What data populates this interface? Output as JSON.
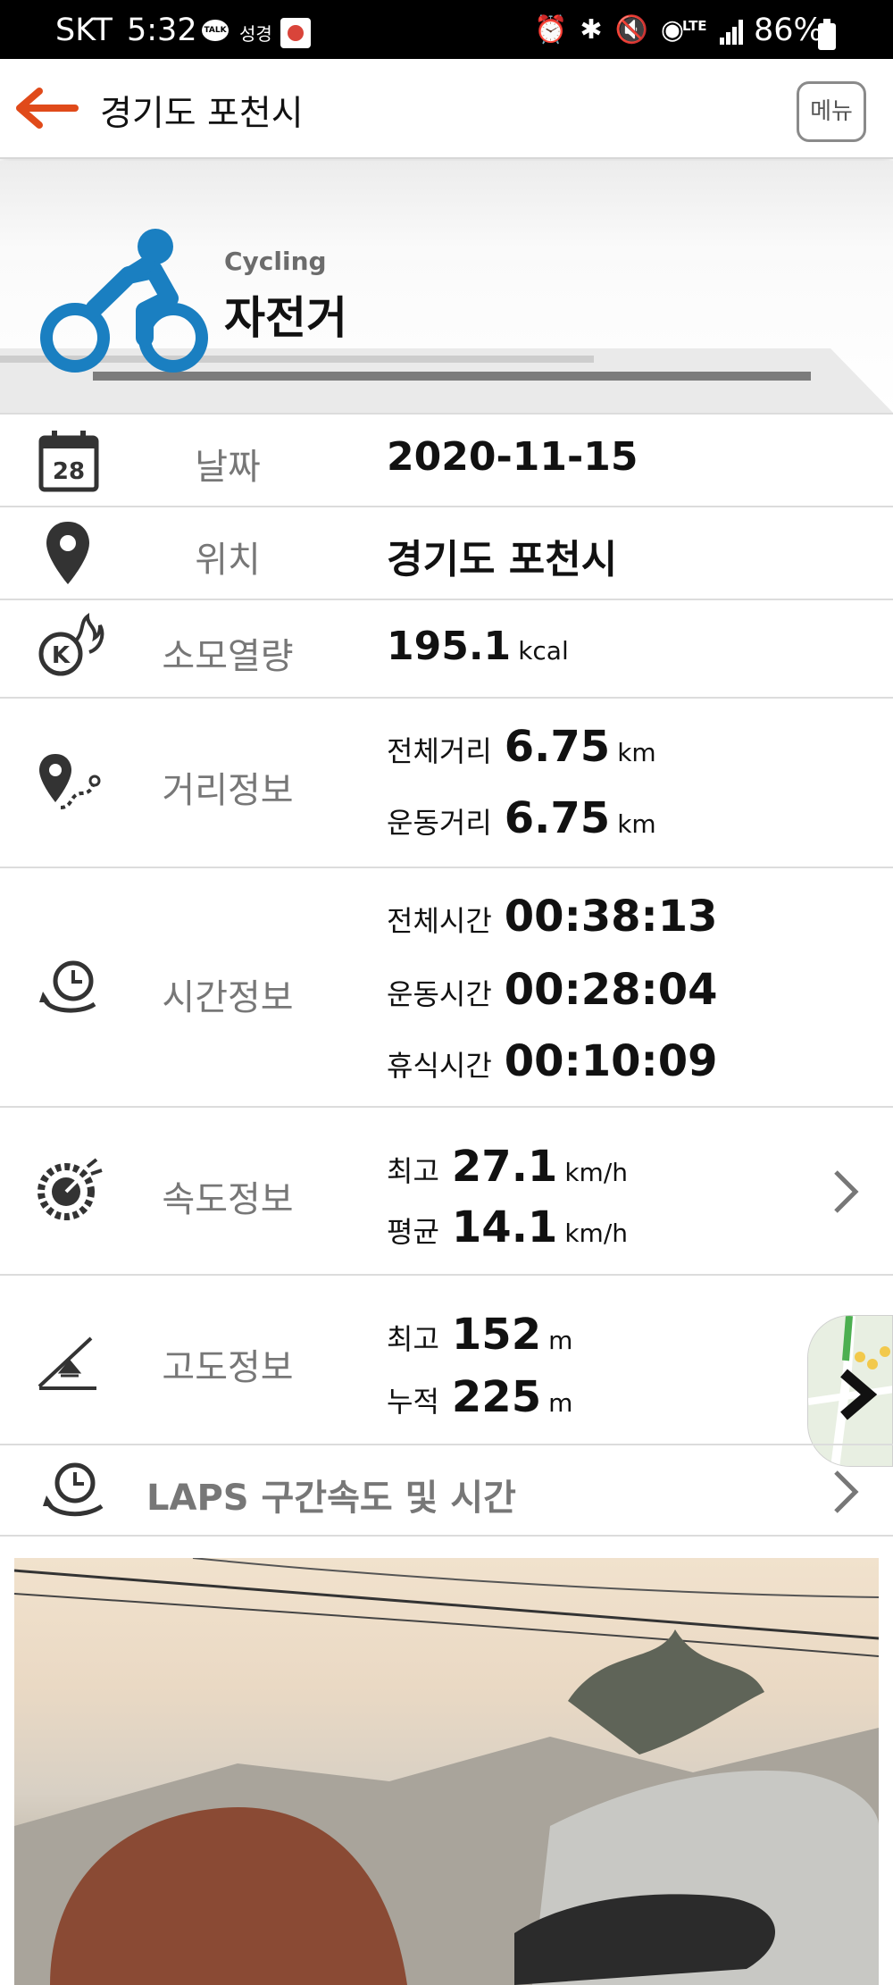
{
  "status_bar": {
    "carrier": "SKT",
    "time": "5:32",
    "talk_badge": "TALK",
    "sub_text": "성경",
    "lte": "LTE",
    "battery": "86%"
  },
  "header": {
    "title": "경기도 포천시",
    "menu_label": "메뉴"
  },
  "activity": {
    "subtitle": "Cycling",
    "title": "자전거",
    "accent_color": "#1a7fc1"
  },
  "rows": {
    "date": {
      "label": "날짜",
      "value": "2020-11-15",
      "icon": "calendar-icon",
      "icon_text": "28"
    },
    "location": {
      "label": "위치",
      "value": "경기도 포천시",
      "icon": "location-pin-icon"
    },
    "calories": {
      "label": "소모열량",
      "value": "195.1",
      "unit": "kcal",
      "icon": "calorie-flame-icon"
    },
    "distance": {
      "label": "거리정보",
      "icon": "route-pin-icon",
      "total_key": "전체거리",
      "total_value": "6.75",
      "total_unit": "km",
      "moving_key": "운동거리",
      "moving_value": "6.75",
      "moving_unit": "km"
    },
    "time": {
      "label": "시간정보",
      "icon": "clock-cycle-icon",
      "total_key": "전체시간",
      "total_value": "00:38:13",
      "moving_key": "운동시간",
      "moving_value": "00:28:04",
      "rest_key": "휴식시간",
      "rest_value": "00:10:09"
    },
    "speed": {
      "label": "속도정보",
      "icon": "speedometer-icon",
      "max_key": "최고",
      "max_value": "27.1",
      "max_unit": "km/h",
      "avg_key": "평균",
      "avg_value": "14.1",
      "avg_unit": "km/h"
    },
    "altitude": {
      "label": "고도정보",
      "icon": "altitude-slope-icon",
      "max_key": "최고",
      "max_value": "152",
      "max_unit": "m",
      "cum_key": "누적",
      "cum_value": "225",
      "cum_unit": "m"
    },
    "laps": {
      "label": "LAPS 구간속도 및 시간",
      "icon": "laps-clock-icon"
    }
  }
}
